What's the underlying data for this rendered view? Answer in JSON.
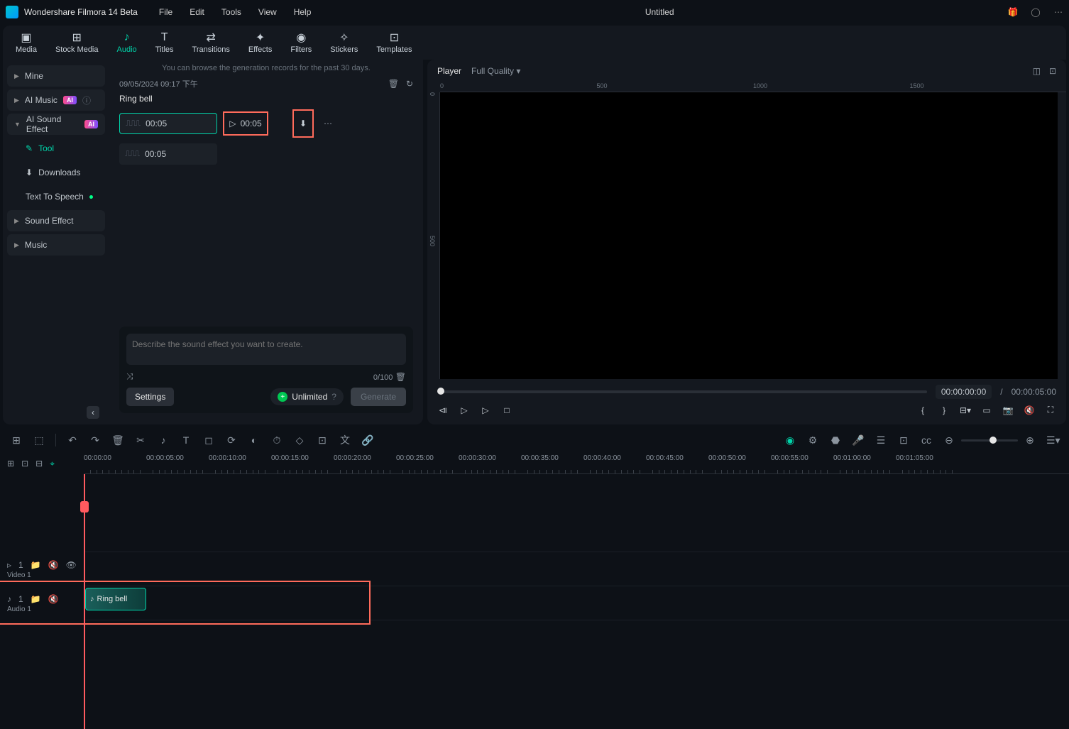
{
  "app": {
    "name": "Wondershare Filmora 14 Beta",
    "docTitle": "Untitled"
  },
  "menus": [
    "File",
    "Edit",
    "Tools",
    "View",
    "Help"
  ],
  "tabs": [
    {
      "label": "Media"
    },
    {
      "label": "Stock Media"
    },
    {
      "label": "Audio",
      "active": true
    },
    {
      "label": "Titles"
    },
    {
      "label": "Transitions"
    },
    {
      "label": "Effects"
    },
    {
      "label": "Filters"
    },
    {
      "label": "Stickers"
    },
    {
      "label": "Templates"
    }
  ],
  "sidebar": {
    "items": [
      {
        "label": "Mine"
      },
      {
        "label": "AI Music",
        "ai": true
      },
      {
        "label": "AI Sound Effect",
        "ai": true,
        "expanded": true
      },
      {
        "label": "Tool",
        "sub": true,
        "active": true
      },
      {
        "label": "Downloads",
        "sub": true
      },
      {
        "label": "Text To Speech",
        "sub": true,
        "dot": true
      },
      {
        "label": "Sound Effect"
      },
      {
        "label": "Music"
      }
    ]
  },
  "content": {
    "hint": "You can browse the generation records for the past 30 days.",
    "timestamp": "09/05/2024 09:17 下午",
    "title": "Ring bell",
    "clipA": "00:05",
    "clipB": "00:05",
    "playTime": "00:05"
  },
  "prompt": {
    "placeholder": "Describe the sound effect you want to create.",
    "counter": "0/100",
    "settings": "Settings",
    "unlimited": "Unlimited",
    "generate": "Generate"
  },
  "player": {
    "tab": "Player",
    "quality": "Full Quality",
    "rulerH": [
      "0",
      "500",
      "1000",
      "1500"
    ],
    "rulerV": [
      "0",
      "500"
    ],
    "current": "00:00:00:00",
    "total": "00:00:05:00"
  },
  "timeline": {
    "ticks": [
      "00:00:00",
      "00:00:05:00",
      "00:00:10:00",
      "00:00:15:00",
      "00:00:20:00",
      "00:00:25:00",
      "00:00:30:00",
      "00:00:35:00",
      "00:00:40:00",
      "00:00:45:00",
      "00:00:50:00",
      "00:00:55:00",
      "00:01:00:00",
      "00:01:05:00"
    ],
    "videoTrack": {
      "num": "1",
      "label": "Video 1"
    },
    "audioTrack": {
      "num": "1",
      "label": "Audio 1"
    },
    "clipName": "Ring bell"
  }
}
